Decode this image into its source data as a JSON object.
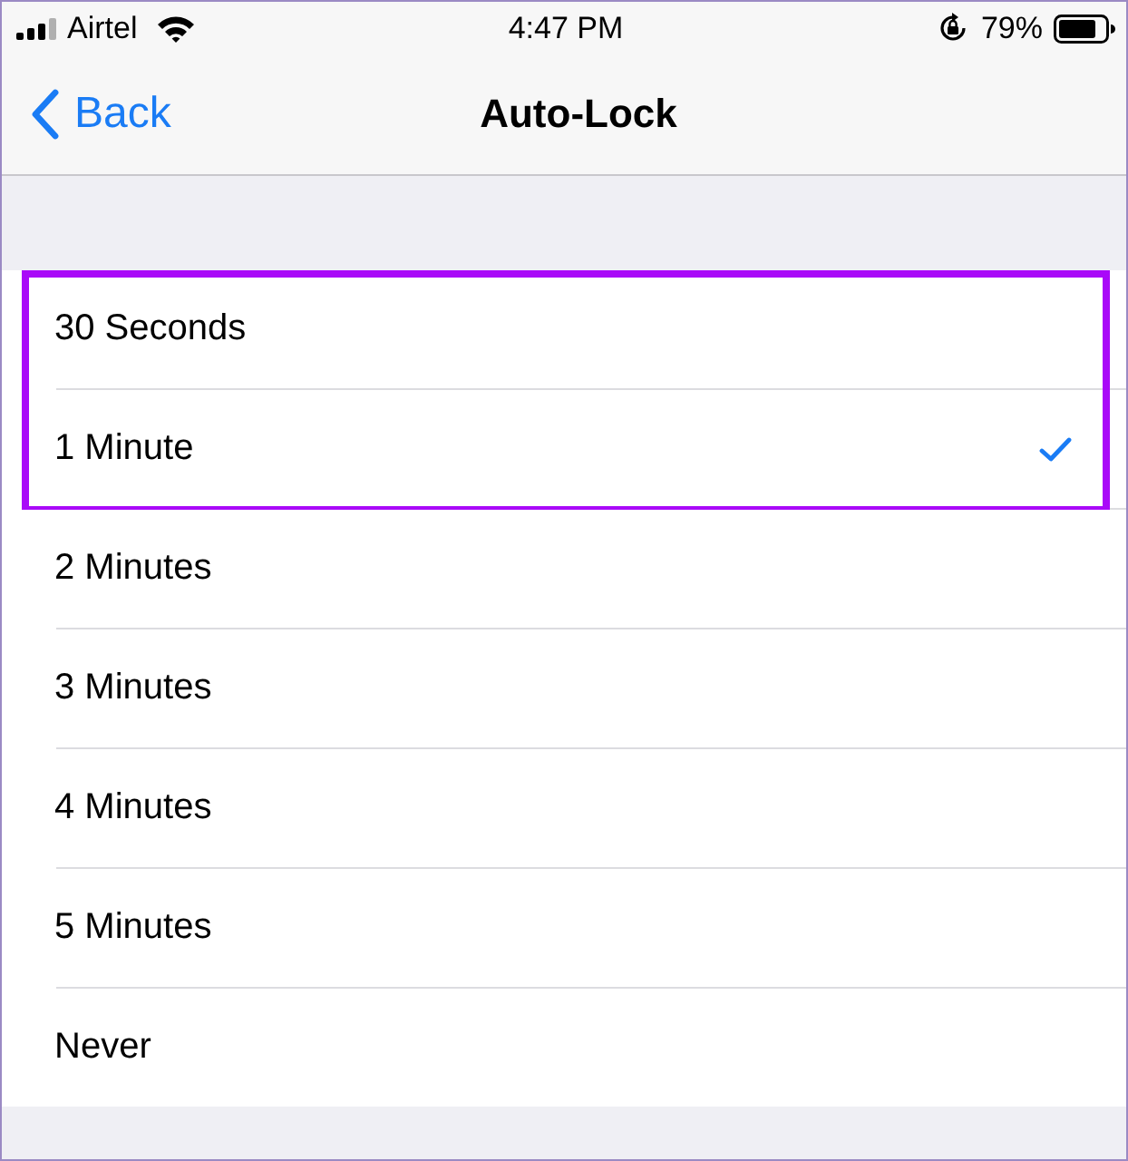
{
  "status_bar": {
    "carrier": "Airtel",
    "time": "4:47 PM",
    "battery": "79%"
  },
  "nav_bar": {
    "back": "Back",
    "title": "Auto-Lock"
  },
  "options": [
    {
      "label": "30 Seconds",
      "selected": false,
      "highlighted": true
    },
    {
      "label": "1 Minute",
      "selected": true,
      "highlighted": true
    },
    {
      "label": "2 Minutes",
      "selected": false,
      "highlighted": false
    },
    {
      "label": "3 Minutes",
      "selected": false,
      "highlighted": false
    },
    {
      "label": "4 Minutes",
      "selected": false,
      "highlighted": false
    },
    {
      "label": "5 Minutes",
      "selected": false,
      "highlighted": false
    },
    {
      "label": "Never",
      "selected": false,
      "highlighted": false
    }
  ]
}
